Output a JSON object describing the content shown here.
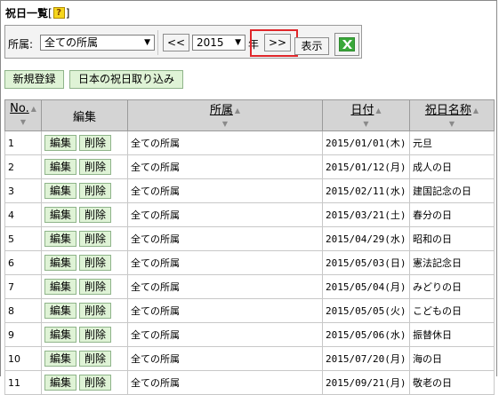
{
  "header": {
    "title": "祝日一覧",
    "bracket_open": "[",
    "help_icon": "question-icon",
    "help_glyph": "?",
    "bracket_close": "]"
  },
  "filter": {
    "affiliation_label": "所属:",
    "affiliation_value": "全ての所属",
    "prev_label": "<<",
    "year_value": "2015",
    "year_label": "年",
    "next_label": ">>",
    "show_label": "表示",
    "excel_icon": "excel-export-icon"
  },
  "actions": {
    "new_label": "新規登録",
    "import_label": "日本の祝日取り込み"
  },
  "colors": {
    "highlight": "#e0262a",
    "button_green": "#dff3d6",
    "header_gray": "#d4d4d4"
  },
  "table": {
    "columns": [
      "No.",
      "編集",
      "所属",
      "日付",
      "祝日名称"
    ],
    "edit_label": "編集",
    "delete_label": "削除",
    "rows": [
      {
        "no": "1",
        "affiliation": "全ての所属",
        "date": "2015/01/01(木)",
        "name": "元旦"
      },
      {
        "no": "2",
        "affiliation": "全ての所属",
        "date": "2015/01/12(月)",
        "name": "成人の日"
      },
      {
        "no": "3",
        "affiliation": "全ての所属",
        "date": "2015/02/11(水)",
        "name": "建国記念の日"
      },
      {
        "no": "4",
        "affiliation": "全ての所属",
        "date": "2015/03/21(土)",
        "name": "春分の日"
      },
      {
        "no": "5",
        "affiliation": "全ての所属",
        "date": "2015/04/29(水)",
        "name": "昭和の日"
      },
      {
        "no": "6",
        "affiliation": "全ての所属",
        "date": "2015/05/03(日)",
        "name": "憲法記念日"
      },
      {
        "no": "7",
        "affiliation": "全ての所属",
        "date": "2015/05/04(月)",
        "name": "みどりの日"
      },
      {
        "no": "8",
        "affiliation": "全ての所属",
        "date": "2015/05/05(火)",
        "name": "こどもの日"
      },
      {
        "no": "9",
        "affiliation": "全ての所属",
        "date": "2015/05/06(水)",
        "name": "振替休日"
      },
      {
        "no": "10",
        "affiliation": "全ての所属",
        "date": "2015/07/20(月)",
        "name": "海の日"
      },
      {
        "no": "11",
        "affiliation": "全ての所属",
        "date": "2015/09/21(月)",
        "name": "敬老の日"
      }
    ]
  }
}
